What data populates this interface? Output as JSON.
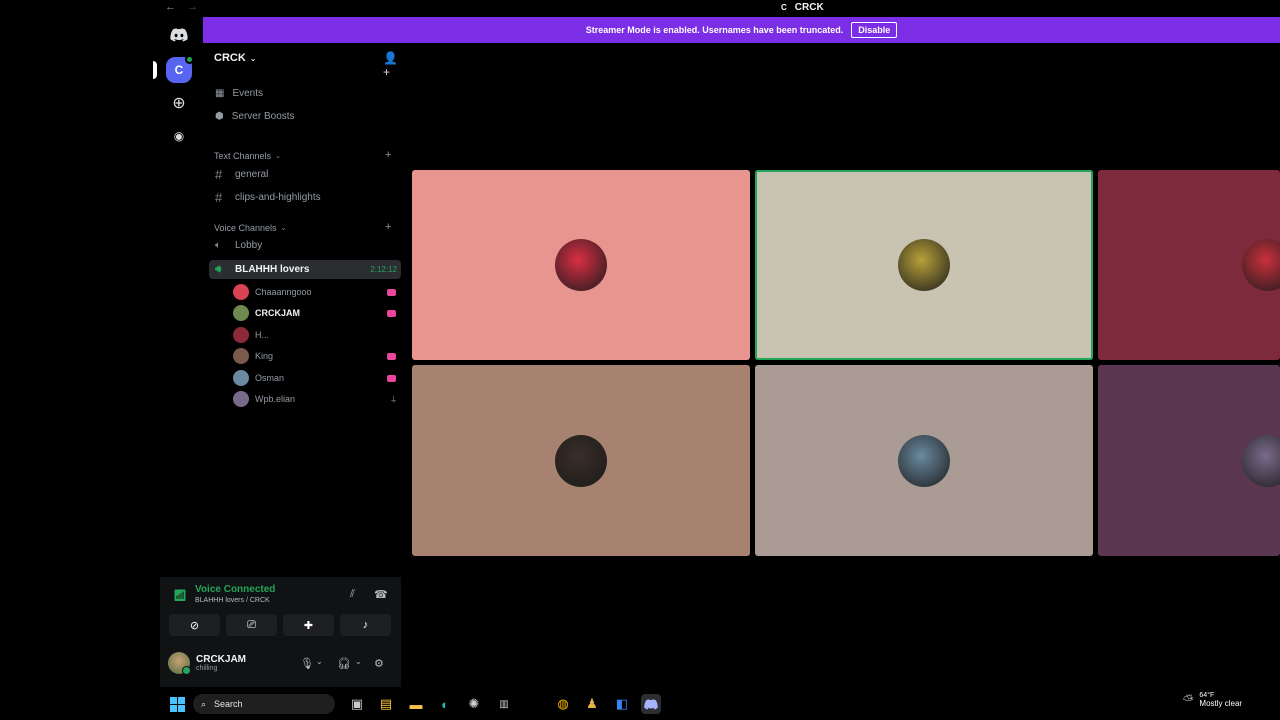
{
  "window": {
    "title": "CRCK",
    "back_icon": "arrow-left-icon",
    "forward_icon": "arrow-right-icon"
  },
  "banner": {
    "text": "Streamer Mode is enabled. Usernames have been truncated.",
    "button": "Disable"
  },
  "rail": {
    "server_initial": "C"
  },
  "server": {
    "name": "CRCK",
    "nav": [
      {
        "label": "Events",
        "icon": "calendar-icon"
      },
      {
        "label": "Server Boosts",
        "icon": "boost-icon"
      }
    ],
    "text_category": "Text Channels",
    "text_channels": [
      "general",
      "clips-and-highlights"
    ],
    "voice_category": "Voice Channels",
    "voice_channels": [
      {
        "name": "Lobby"
      },
      {
        "name": "BLAHHH lovers",
        "timer": "2:12:12"
      }
    ],
    "members": [
      {
        "name": "Chaaanngooo",
        "live": true,
        "color": "#d94155"
      },
      {
        "name": "CRCKJAM",
        "live": true,
        "me": true,
        "color": "#6e8a4e"
      },
      {
        "name": "H...",
        "live": false,
        "color": "#8d2a3a"
      },
      {
        "name": "King",
        "live": true,
        "color": "#7a5a48"
      },
      {
        "name": "Osman",
        "live": true,
        "color": "#6a8aa0"
      },
      {
        "name": "Wpb.elian",
        "live": false,
        "deafened": true,
        "color": "#7a6a8a"
      }
    ]
  },
  "voice_panel": {
    "status": "Voice Connected",
    "channel": "BLAHHH lovers / CRCK",
    "user": "CRCKJAM",
    "activity": "chilling"
  },
  "tiles": [
    {
      "bg": "#e8958f",
      "avatar": "#d92f45",
      "speaking": false
    },
    {
      "bg": "#c8c4b1",
      "avatar": "#b8a23a",
      "speaking": true
    },
    {
      "bg": "#7e2a3d",
      "avatar": "#c8303c",
      "speaking": false
    },
    {
      "bg": "#a88270",
      "avatar": "#3a2e28",
      "speaking": false
    },
    {
      "bg": "#aa9b95",
      "avatar": "#6a8aa0",
      "speaking": false
    },
    {
      "bg": "#5a3650",
      "avatar": "#7a6a8a",
      "speaking": false
    }
  ],
  "taskbar": {
    "search": "Search",
    "temp": "64°F",
    "weather": "Mostly clear"
  }
}
